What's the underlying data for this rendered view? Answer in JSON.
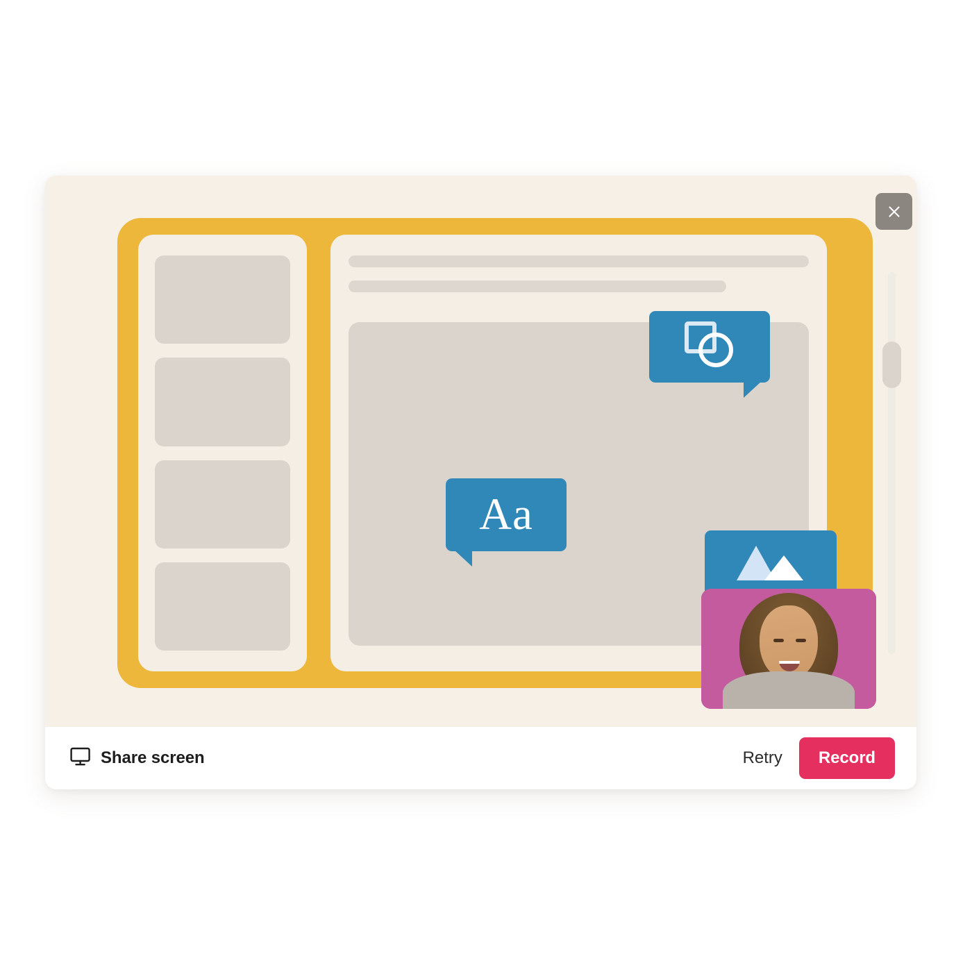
{
  "dialog": {
    "close_icon": "close-icon",
    "close_label": "Close"
  },
  "preview": {
    "sidebar": {
      "thumbnails": [
        {
          "label": "Slide thumbnail 1"
        },
        {
          "label": "Slide thumbnail 2"
        },
        {
          "label": "Slide thumbnail 3"
        },
        {
          "label": "Slide thumbnail 4"
        }
      ]
    },
    "content": {
      "skeleton_lines": [
        {
          "label": "Title placeholder line"
        },
        {
          "label": "Subtitle placeholder line"
        }
      ],
      "block_label": "Slide content placeholder"
    },
    "scrollbar": {
      "label": "Vertical scrollbar",
      "thumb_label": "Scrollbar thumb"
    },
    "callouts": [
      {
        "id": "shapes",
        "icon": "shapes-icon",
        "label": "Shapes",
        "tail": "right"
      },
      {
        "id": "text",
        "icon": "text-icon",
        "label": "Aa",
        "tail": "left"
      },
      {
        "id": "image",
        "icon": "image-icon",
        "label": "Images",
        "tail": "right"
      }
    ],
    "webcam": {
      "label": "Webcam preview",
      "background_color": "#c45b9f"
    }
  },
  "footer": {
    "share_screen": {
      "icon": "monitor-icon",
      "label": "Share screen"
    },
    "retry_label": "Retry",
    "record_label": "Record"
  },
  "colors": {
    "frame_yellow": "#edb73c",
    "panel_cream": "#f5eee4",
    "card_cream": "#f7f0e7",
    "placeholder_gray": "#dbd4cc",
    "bubble_blue": "#3088b8",
    "record_pink": "#e5305f",
    "webcam_magenta": "#c45b9f",
    "close_gray": "#8c8681"
  }
}
